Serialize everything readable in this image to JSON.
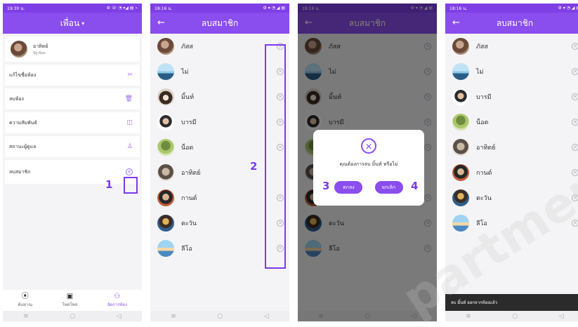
{
  "status": {
    "time_p1": "19:30 น.",
    "time_p2": "18:16 น.",
    "time_p3": "18:16 น.",
    "time_p4": "18:16 น.",
    "icons_p1": "⚙ ☏ ◔ ▾◢ ▤ ⌁",
    "icons_other": "⚙ ▾ ◔ ◢ ▤"
  },
  "screen1": {
    "title": "เพื่อน",
    "profile": {
      "name": "อาทิตย์",
      "subtitle": "ปุ้ยู-ฟ้อด"
    },
    "options": [
      {
        "label": "แก้ไขชื่อห้อง",
        "icon": "✂"
      },
      {
        "label": "ลบห้อง",
        "icon": "🗑"
      },
      {
        "label": "ความสัมพันธ์",
        "icon": "◫"
      },
      {
        "label": "สถานะผู้ดูแล",
        "icon": "♙"
      },
      {
        "label": "ลบสมาชิก",
        "icon": "✕"
      }
    ],
    "tabs": [
      {
        "label": "ค้นหาณ",
        "icon": "⦿"
      },
      {
        "label": "โพสโพส",
        "icon": "▣"
      },
      {
        "label": "จัดการห้อง",
        "icon": "⚇"
      }
    ]
  },
  "screen2": {
    "title": "ลบสมาชิก",
    "members": [
      "ภัสส",
      "ไม่",
      "มิ้นท์",
      "บารมี",
      "น็อต",
      "อาทิตย์",
      "กานต์",
      "ตะวัน",
      "ลีโอ"
    ]
  },
  "screen3": {
    "dialog_icon": "✕",
    "dialog_text": "คุณต้องการลบ มิ้นท์ หรือไม่",
    "confirm": "ตกลง",
    "cancel": "ยกเลิก"
  },
  "screen4": {
    "members": [
      "ภัสส",
      "ไม่",
      "บารมี",
      "น็อต",
      "อาทิตย์",
      "กานต์",
      "ตะวัน",
      "ลีโอ"
    ],
    "toast": "ลบ มิ้นท์ ออกจากห้องแล้ว"
  },
  "annotations": {
    "n1": "1",
    "n2": "2",
    "n3": "3",
    "n4": "4"
  },
  "nav": {
    "menu": "≡",
    "home": "○",
    "back": "◁"
  },
  "watermark": "partment Uni",
  "colors": {
    "accent": "#8a4dee",
    "annotation": "#7c3aed"
  }
}
